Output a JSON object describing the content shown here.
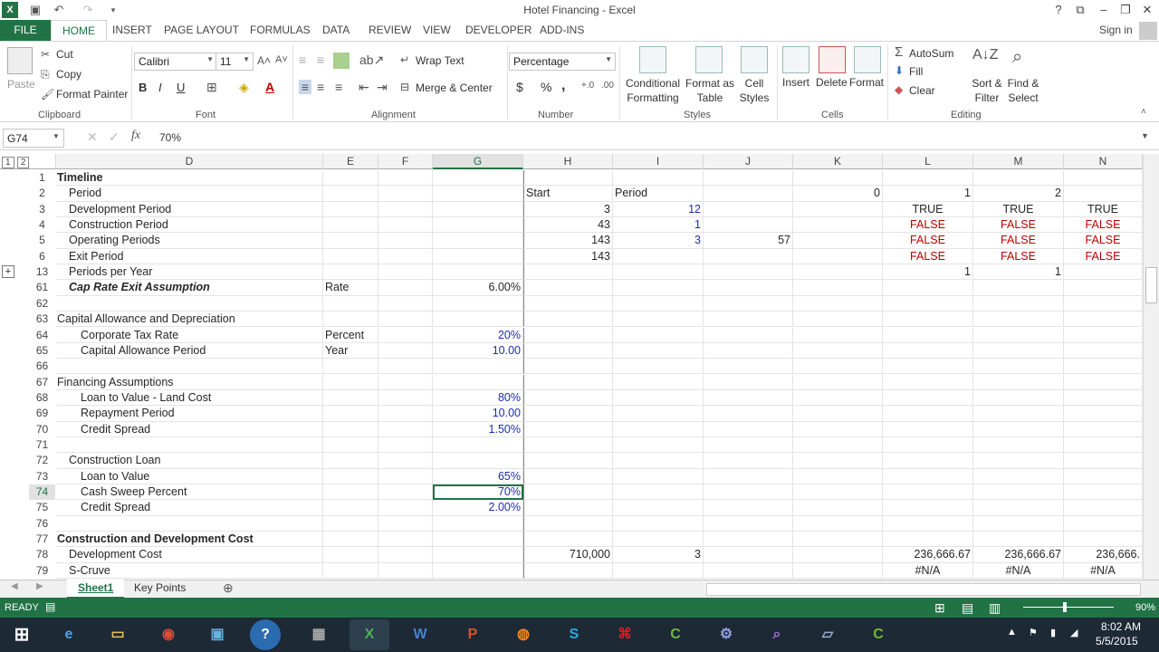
{
  "window": {
    "title": "Hotel Financing - Excel",
    "signin": "Sign in"
  },
  "tabs": [
    "FILE",
    "HOME",
    "INSERT",
    "PAGE LAYOUT",
    "FORMULAS",
    "DATA",
    "REVIEW",
    "VIEW",
    "DEVELOPER",
    "ADD-INS"
  ],
  "ribbon": {
    "clipboard": {
      "paste": "Paste",
      "cut": "Cut",
      "copy": "Copy",
      "format_painter": "Format Painter",
      "label": "Clipboard"
    },
    "font": {
      "name": "Calibri",
      "size": "11",
      "label": "Font",
      "bold": "B",
      "italic": "I",
      "underline": "U"
    },
    "alignment": {
      "wrap": "Wrap Text",
      "merge": "Merge & Center",
      "label": "Alignment"
    },
    "number": {
      "format": "Percentage",
      "currency": "$",
      "percent": "%",
      "comma": ",",
      "label": "Number"
    },
    "styles": {
      "conditional": "Conditional Formatting",
      "format_as_table": "Format as Table",
      "cell_styles": "Cell Styles",
      "label": "Styles"
    },
    "cells": {
      "insert": "Insert",
      "delete": "Delete",
      "format": "Format",
      "label": "Cells"
    },
    "editing": {
      "autosum": "AutoSum",
      "fill": "Fill",
      "clear": "Clear",
      "sort": "Sort & Filter",
      "find": "Find & Select",
      "label": "Editing"
    }
  },
  "formula": {
    "namebox": "G74",
    "value": "70%",
    "fx": "fx"
  },
  "columns": [
    "ABC",
    "D",
    "E",
    "F",
    "G",
    "H",
    "I",
    "J",
    "K",
    "L",
    "M",
    "N"
  ],
  "rows": [
    {
      "n": "1",
      "D": "Timeline",
      "Dstyle": "b",
      "Dind": 0
    },
    {
      "n": "2",
      "D": "Period",
      "Dind": 1,
      "H": "Start",
      "I": "Period",
      "K": "0",
      "L": "1",
      "M": "2"
    },
    {
      "n": "3",
      "D": "Development Period",
      "Dind": 1,
      "H": "3",
      "I": "12",
      "L": "TRUE",
      "M": "TRUE",
      "N": "TRUE"
    },
    {
      "n": "4",
      "D": "Construction Period",
      "Dind": 1,
      "H": "43",
      "I": "1",
      "L": "FALSE",
      "M": "FALSE",
      "N": "FALSE"
    },
    {
      "n": "5",
      "D": "Operating Periods",
      "Dind": 1,
      "H": "143",
      "I": "3",
      "J": "57",
      "L": "FALSE",
      "M": "FALSE",
      "N": "FALSE"
    },
    {
      "n": "6",
      "D": "Exit Period",
      "Dind": 1,
      "H": "143",
      "L": "FALSE",
      "M": "FALSE",
      "N": "FALSE"
    },
    {
      "n": "13",
      "D": "Periods per Year",
      "Dind": 1,
      "L": "1",
      "M": "1"
    },
    {
      "n": "61",
      "D": "Cap Rate Exit Assumption",
      "Dstyle": "bi",
      "Dind": 1,
      "E": "Rate",
      "G": "6.00%"
    },
    {
      "n": "62"
    },
    {
      "n": "63",
      "D": "Capital Allowance and Depreciation",
      "Dind": 0
    },
    {
      "n": "64",
      "D": "Corporate Tax Rate",
      "Dind": 2,
      "E": "Percent",
      "G": "20%",
      "Gblue": true
    },
    {
      "n": "65",
      "D": "Capital Allowance Period",
      "Dind": 2,
      "E": "Year",
      "G": "10.00",
      "Gblue": true
    },
    {
      "n": "66"
    },
    {
      "n": "67",
      "D": "Financing Assumptions",
      "Dind": 0
    },
    {
      "n": "68",
      "D": "Loan to Value - Land Cost",
      "Dind": 2,
      "G": "80%",
      "Gblue": true
    },
    {
      "n": "69",
      "D": "Repayment Period",
      "Dind": 2,
      "G": "10.00",
      "Gblue": true
    },
    {
      "n": "70",
      "D": "Credit Spread",
      "Dind": 2,
      "G": "1.50%",
      "Gblue": true
    },
    {
      "n": "71"
    },
    {
      "n": "72",
      "D": "Construction Loan",
      "Dind": 1
    },
    {
      "n": "73",
      "D": "Loan to Value",
      "Dind": 2,
      "G": "65%",
      "Gblue": true
    },
    {
      "n": "74",
      "D": "Cash Sweep Percent",
      "Dind": 2,
      "G": "70%",
      "Gblue": true,
      "selected": true
    },
    {
      "n": "75",
      "D": "Credit Spread",
      "Dind": 2,
      "G": "2.00%",
      "Gblue": true
    },
    {
      "n": "76"
    },
    {
      "n": "77",
      "D": "Construction and Development Cost",
      "Dstyle": "b",
      "Dind": 0
    },
    {
      "n": "78",
      "D": "Development Cost",
      "Dind": 1,
      "H": "710,000",
      "I": "3",
      "L": "236,666.67",
      "M": "236,666.67",
      "N": "236,666."
    },
    {
      "n": "79",
      "D": "S-Cruve",
      "Dind": 1,
      "L": "#N/A",
      "M": "#N/A",
      "N": "#N/A"
    }
  ],
  "sheets": [
    "Sheet1",
    "Key Points"
  ],
  "status": {
    "ready": "READY",
    "zoom": "90%"
  },
  "clock": {
    "time": "8:02 AM",
    "date": "5/5/2015"
  }
}
